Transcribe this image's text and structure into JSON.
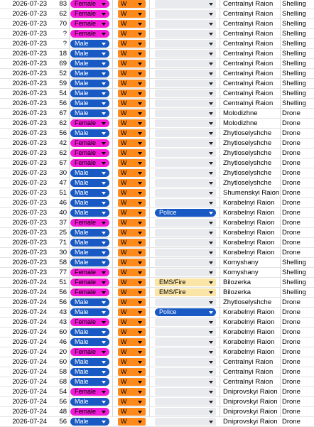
{
  "colors": {
    "female": "#f21ad6",
    "male": "#1859c4",
    "w": "#ff8a1c",
    "blank_dropdown": "#e8eaed",
    "police": "#1859c4",
    "ems_fire": "#fbe5a6"
  },
  "rows": [
    {
      "date": "2026-07-23",
      "age": "83",
      "gender": "Female",
      "w": "W",
      "responder": "",
      "location": "Centralnyi Raion",
      "type": "Shelling"
    },
    {
      "date": "2026-07-23",
      "age": "62",
      "gender": "Female",
      "w": "W",
      "responder": "",
      "location": "Centralnyi Raion",
      "type": "Shelling"
    },
    {
      "date": "2026-07-23",
      "age": "70",
      "gender": "Female",
      "w": "W",
      "responder": "",
      "location": "Centralnyi Raion",
      "type": "Shelling"
    },
    {
      "date": "2026-07-23",
      "age": "?",
      "gender": "Female",
      "w": "W",
      "responder": "",
      "location": "Centralnyi Raion",
      "type": "Shelling"
    },
    {
      "date": "2026-07-23",
      "age": "?",
      "gender": "Male",
      "w": "W",
      "responder": "",
      "location": "Centralnyi Raion",
      "type": "Shelling"
    },
    {
      "date": "2026-07-23",
      "age": "18",
      "gender": "Male",
      "w": "W",
      "responder": "",
      "location": "Centralnyi Raion",
      "type": "Shelling"
    },
    {
      "date": "2026-07-23",
      "age": "69",
      "gender": "Male",
      "w": "W",
      "responder": "",
      "location": "Centralnyi Raion",
      "type": "Shelling"
    },
    {
      "date": "2026-07-23",
      "age": "52",
      "gender": "Male",
      "w": "W",
      "responder": "",
      "location": "Centralnyi Raion",
      "type": "Shelling"
    },
    {
      "date": "2026-07-23",
      "age": "59",
      "gender": "Male",
      "w": "W",
      "responder": "",
      "location": "Centralnyi Raion",
      "type": "Shelling"
    },
    {
      "date": "2026-07-23",
      "age": "54",
      "gender": "Male",
      "w": "W",
      "responder": "",
      "location": "Centralnyi Raion",
      "type": "Shelling"
    },
    {
      "date": "2026-07-23",
      "age": "56",
      "gender": "Male",
      "w": "W",
      "responder": "",
      "location": "Centralnyi Raion",
      "type": "Shelling"
    },
    {
      "date": "2026-07-23",
      "age": "67",
      "gender": "Male",
      "w": "W",
      "responder": "",
      "location": "Molodizhne",
      "type": "Drone"
    },
    {
      "date": "2026-07-23",
      "age": "62",
      "gender": "Female",
      "w": "W",
      "responder": "",
      "location": "Molodizhne",
      "type": "Drone"
    },
    {
      "date": "2026-07-23",
      "age": "56",
      "gender": "Male",
      "w": "W",
      "responder": "",
      "location": "Zhytloselyshche",
      "type": "Drone"
    },
    {
      "date": "2026-07-23",
      "age": "42",
      "gender": "Female",
      "w": "W",
      "responder": "",
      "location": "Zhytloselyshche",
      "type": "Drone"
    },
    {
      "date": "2026-07-23",
      "age": "62",
      "gender": "Female",
      "w": "W",
      "responder": "",
      "location": "Zhytloselyshche",
      "type": "Drone"
    },
    {
      "date": "2026-07-23",
      "age": "67",
      "gender": "Female",
      "w": "W",
      "responder": "",
      "location": "Zhytloselyshche",
      "type": "Drone"
    },
    {
      "date": "2026-07-23",
      "age": "30",
      "gender": "Male",
      "w": "W",
      "responder": "",
      "location": "Zhytloselyshche",
      "type": "Drone"
    },
    {
      "date": "2026-07-23",
      "age": "47",
      "gender": "Male",
      "w": "W",
      "responder": "",
      "location": "Zhytloselyshche",
      "type": "Drone"
    },
    {
      "date": "2026-07-23",
      "age": "51",
      "gender": "Male",
      "w": "W",
      "responder": "",
      "location": "Shumenskyi Raion",
      "type": "Drone"
    },
    {
      "date": "2026-07-23",
      "age": "46",
      "gender": "Male",
      "w": "W",
      "responder": "",
      "location": "Korabelnyi Raion",
      "type": "Drone"
    },
    {
      "date": "2026-07-23",
      "age": "40",
      "gender": "Male",
      "w": "W",
      "responder": "Police",
      "location": "Korabelnyi Raion",
      "type": "Drone"
    },
    {
      "date": "2026-07-23",
      "age": "37",
      "gender": "Female",
      "w": "W",
      "responder": "",
      "location": "Korabelnyi Raion",
      "type": "Drone"
    },
    {
      "date": "2026-07-23",
      "age": "25",
      "gender": "Male",
      "w": "W",
      "responder": "",
      "location": "Korabelnyi Raion",
      "type": "Drone"
    },
    {
      "date": "2026-07-23",
      "age": "71",
      "gender": "Male",
      "w": "W",
      "responder": "",
      "location": "Korabelnyi Raion",
      "type": "Drone"
    },
    {
      "date": "2026-07-23",
      "age": "30",
      "gender": "Male",
      "w": "W",
      "responder": "",
      "location": "Korabelnyi Raion",
      "type": "Drone"
    },
    {
      "date": "2026-07-23",
      "age": "58",
      "gender": "Male",
      "w": "W",
      "responder": "",
      "location": "Komyshany",
      "type": "Shelling"
    },
    {
      "date": "2026-07-23",
      "age": "77",
      "gender": "Female",
      "w": "W",
      "responder": "",
      "location": "Komyshany",
      "type": "Shelling"
    },
    {
      "date": "2026-07-24",
      "age": "51",
      "gender": "Female",
      "w": "W",
      "responder": "EMS/Fire",
      "location": "Bilozerka",
      "type": "Shelling"
    },
    {
      "date": "2026-07-24",
      "age": "56",
      "gender": "Female",
      "w": "W",
      "responder": "EMS/Fire",
      "location": "Bilozerka",
      "type": "Shelling"
    },
    {
      "date": "2026-07-24",
      "age": "56",
      "gender": "Male",
      "w": "W",
      "responder": "",
      "location": "Zhytloselyshche",
      "type": "Drone"
    },
    {
      "date": "2026-07-24",
      "age": "43",
      "gender": "Male",
      "w": "W",
      "responder": "Police",
      "location": "Korabelnyi Raion",
      "type": "Drone"
    },
    {
      "date": "2026-07-24",
      "age": "43",
      "gender": "Female",
      "w": "W",
      "responder": "",
      "location": "Korabelnyi Raion",
      "type": "Drone"
    },
    {
      "date": "2026-07-24",
      "age": "60",
      "gender": "Male",
      "w": "W",
      "responder": "",
      "location": "Korabelnyi Raion",
      "type": "Drone"
    },
    {
      "date": "2026-07-24",
      "age": "46",
      "gender": "Male",
      "w": "W",
      "responder": "",
      "location": "Korabelnyi Raion",
      "type": "Drone"
    },
    {
      "date": "2026-07-24",
      "age": "20",
      "gender": "Female",
      "w": "W",
      "responder": "",
      "location": "Korabelnyi Raion",
      "type": "Drone"
    },
    {
      "date": "2026-07-24",
      "age": "60",
      "gender": "Male",
      "w": "W",
      "responder": "",
      "location": "Centralnyi Raion",
      "type": "Drone"
    },
    {
      "date": "2026-07-24",
      "age": "58",
      "gender": "Male",
      "w": "W",
      "responder": "",
      "location": "Centralnyi Raion",
      "type": "Drone"
    },
    {
      "date": "2026-07-24",
      "age": "68",
      "gender": "Male",
      "w": "W",
      "responder": "",
      "location": "Centralnyi Raion",
      "type": "Drone"
    },
    {
      "date": "2026-07-24",
      "age": "54",
      "gender": "Female",
      "w": "W",
      "responder": "",
      "location": "Dniprovskyi Raion",
      "type": "Drone"
    },
    {
      "date": "2026-07-24",
      "age": "56",
      "gender": "Male",
      "w": "W",
      "responder": "",
      "location": "Dniprovskyi Raion",
      "type": "Drone"
    },
    {
      "date": "2026-07-24",
      "age": "48",
      "gender": "Female",
      "w": "W",
      "responder": "",
      "location": "Dniprovskyi Raion",
      "type": "Drone"
    },
    {
      "date": "2026-07-24",
      "age": "56",
      "gender": "Male",
      "w": "W",
      "responder": "",
      "location": "Dniprovskyi Raion",
      "type": "Drone"
    }
  ]
}
